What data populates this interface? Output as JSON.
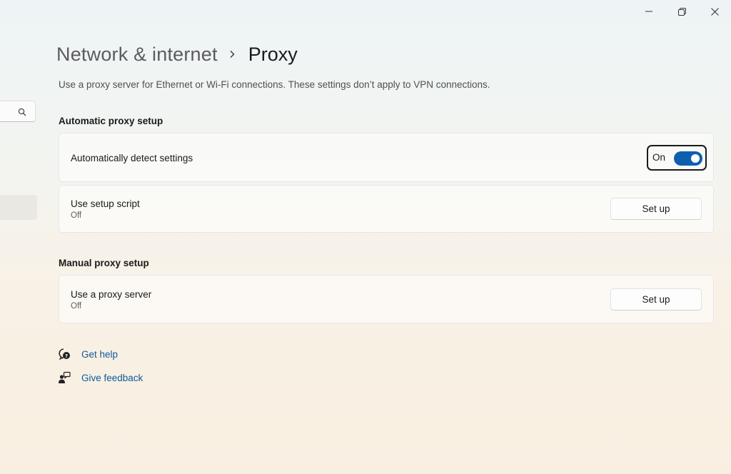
{
  "window": {
    "minimize_icon": "minimize-icon",
    "restore_icon": "restore-icon",
    "close_icon": "close-icon"
  },
  "sidebar": {
    "search_icon": "search-icon"
  },
  "header": {
    "parent": "Network & internet",
    "separator_icon": "chevron-right-icon",
    "current": "Proxy"
  },
  "description": "Use a proxy server for Ethernet or Wi-Fi connections. These settings don’t apply to VPN connections.",
  "automatic": {
    "title": "Automatic proxy setup",
    "detect": {
      "label": "Automatically detect settings",
      "toggle_label": "On",
      "toggle_on": true
    },
    "script": {
      "label": "Use setup script",
      "status": "Off",
      "button": "Set up"
    }
  },
  "manual": {
    "title": "Manual proxy setup",
    "proxy": {
      "label": "Use a proxy server",
      "status": "Off",
      "button": "Set up"
    }
  },
  "links": {
    "help": "Get help",
    "feedback": "Give feedback"
  },
  "colors": {
    "accent": "#0f5fb0",
    "link": "#0b5a9c"
  }
}
